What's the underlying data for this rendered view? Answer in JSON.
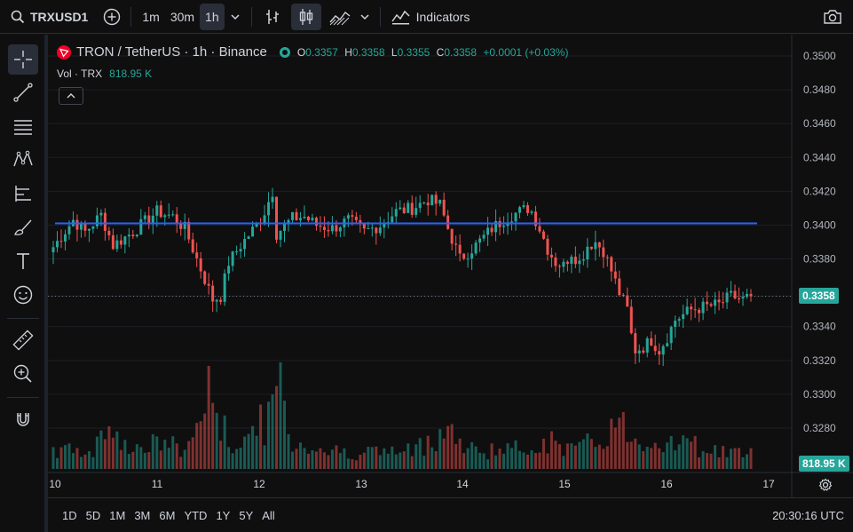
{
  "toolbar": {
    "symbol": "TRXUSD1",
    "intervals": [
      "1m",
      "30m",
      "1h"
    ],
    "active_interval": "1h",
    "indicators_label": "Indicators"
  },
  "legend": {
    "title": "TRON / TetherUS · 1h · Binance",
    "open_key": "O",
    "open": "0.3357",
    "high_key": "H",
    "high": "0.3358",
    "low_key": "L",
    "low": "0.3355",
    "close_key": "C",
    "close": "0.3358",
    "change": "+0.0001 (+0.03%)",
    "vol_label": "Vol · TRX",
    "vol_value": "818.95 K"
  },
  "price_axis": {
    "ticks": [
      "0.3500",
      "0.3480",
      "0.3460",
      "0.3440",
      "0.3420",
      "0.3400",
      "0.3380",
      "0.3358",
      "0.3340",
      "0.3320",
      "0.3300",
      "0.3280"
    ],
    "last_price": "0.3358",
    "last_volume": "818.95 K"
  },
  "time_axis": {
    "labels": [
      "10",
      "11",
      "12",
      "13",
      "14",
      "15",
      "16",
      "17"
    ]
  },
  "ranges": [
    "1D",
    "5D",
    "1M",
    "3M",
    "6M",
    "YTD",
    "1Y",
    "5Y",
    "All"
  ],
  "clock": "20:30:16 UTC",
  "colors": {
    "up": "#26a69a",
    "down": "#ef5350",
    "hline": "#2962ff",
    "bg": "#0f0f0f"
  },
  "chart_data": {
    "type": "candlestick",
    "horizontal_line": 0.3401,
    "price_range": [
      0.327,
      0.3505
    ],
    "days": [
      "10",
      "11",
      "12",
      "13",
      "14",
      "15",
      "16",
      "17"
    ],
    "checkpoints": [
      [
        0,
        0.3387
      ],
      [
        5,
        0.3403
      ],
      [
        8,
        0.3396
      ],
      [
        12,
        0.3406
      ],
      [
        15,
        0.3388
      ],
      [
        20,
        0.3396
      ],
      [
        26,
        0.3408
      ],
      [
        30,
        0.3405
      ],
      [
        33,
        0.3398
      ],
      [
        36,
        0.338
      ],
      [
        38,
        0.3368
      ],
      [
        40,
        0.3356
      ],
      [
        42,
        0.3358
      ],
      [
        44,
        0.3378
      ],
      [
        47,
        0.3388
      ],
      [
        51,
        0.34
      ],
      [
        53,
        0.3408
      ],
      [
        55,
        0.342
      ],
      [
        56,
        0.3395
      ],
      [
        60,
        0.3404
      ],
      [
        63,
        0.3405
      ],
      [
        66,
        0.34
      ],
      [
        70,
        0.3398
      ],
      [
        74,
        0.3403
      ],
      [
        78,
        0.3396
      ],
      [
        82,
        0.34
      ],
      [
        86,
        0.3408
      ],
      [
        90,
        0.341
      ],
      [
        94,
        0.3415
      ],
      [
        97,
        0.3412
      ],
      [
        99,
        0.3398
      ],
      [
        100,
        0.3392
      ],
      [
        102,
        0.338
      ],
      [
        106,
        0.3388
      ],
      [
        110,
        0.3398
      ],
      [
        114,
        0.3405
      ],
      [
        117,
        0.3408
      ],
      [
        119,
        0.341
      ],
      [
        120,
        0.3408
      ],
      [
        122,
        0.3398
      ],
      [
        124,
        0.3386
      ],
      [
        126,
        0.3378
      ],
      [
        128,
        0.3376
      ],
      [
        130,
        0.3384
      ],
      [
        132,
        0.3378
      ],
      [
        134,
        0.3388
      ],
      [
        136,
        0.339
      ],
      [
        138,
        0.3385
      ],
      [
        140,
        0.3373
      ],
      [
        142,
        0.336
      ],
      [
        144,
        0.335
      ],
      [
        145,
        0.3335
      ],
      [
        146,
        0.3326
      ],
      [
        148,
        0.3328
      ],
      [
        150,
        0.3332
      ],
      [
        152,
        0.3326
      ],
      [
        154,
        0.3334
      ],
      [
        156,
        0.3344
      ],
      [
        160,
        0.335
      ],
      [
        164,
        0.3352
      ],
      [
        167,
        0.3353
      ],
      [
        170,
        0.3358
      ],
      [
        173,
        0.3356
      ],
      [
        175,
        0.3358
      ]
    ],
    "volume_checkpoints": [
      [
        0,
        0.2
      ],
      [
        10,
        0.18
      ],
      [
        14,
        0.55
      ],
      [
        20,
        0.2
      ],
      [
        28,
        0.28
      ],
      [
        33,
        0.18
      ],
      [
        40,
        0.85
      ],
      [
        44,
        0.22
      ],
      [
        55,
        0.55
      ],
      [
        57,
        1.0
      ],
      [
        59,
        0.3
      ],
      [
        70,
        0.18
      ],
      [
        90,
        0.18
      ],
      [
        99,
        0.45
      ],
      [
        103,
        0.2
      ],
      [
        118,
        0.2
      ],
      [
        122,
        0.3
      ],
      [
        132,
        0.2
      ],
      [
        140,
        0.4
      ],
      [
        143,
        0.45
      ],
      [
        146,
        0.3
      ],
      [
        155,
        0.3
      ],
      [
        165,
        0.2
      ],
      [
        175,
        0.15
      ]
    ]
  }
}
